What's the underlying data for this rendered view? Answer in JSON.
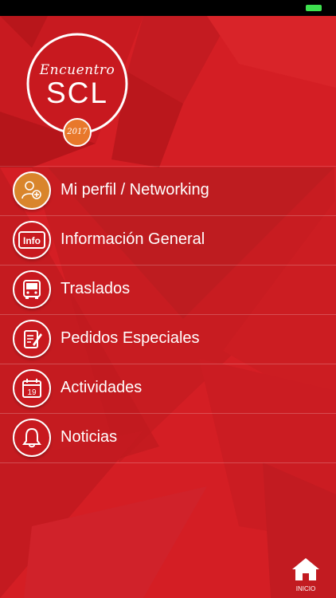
{
  "logo": {
    "script_text": "Encuentro",
    "title": "SCL",
    "year": "2017"
  },
  "menu": {
    "items": [
      {
        "label": "Mi perfil / Networking",
        "icon": "profile-networking-icon"
      },
      {
        "label": "Información General",
        "icon": "info-icon"
      },
      {
        "label": "Traslados",
        "icon": "bus-icon"
      },
      {
        "label": "Pedidos Especiales",
        "icon": "edit-document-icon"
      },
      {
        "label": "Actividades",
        "icon": "calendar-icon",
        "calendar_day": "19"
      },
      {
        "label": "Noticias",
        "icon": "bell-icon"
      }
    ]
  },
  "info_icon_text": "Info",
  "bottom_nav": {
    "home_label": "INICIO",
    "icon": "home-icon"
  },
  "colors": {
    "background": "#d41e24",
    "accent_orange": "#d9852c",
    "battery": "#3ee04f"
  }
}
